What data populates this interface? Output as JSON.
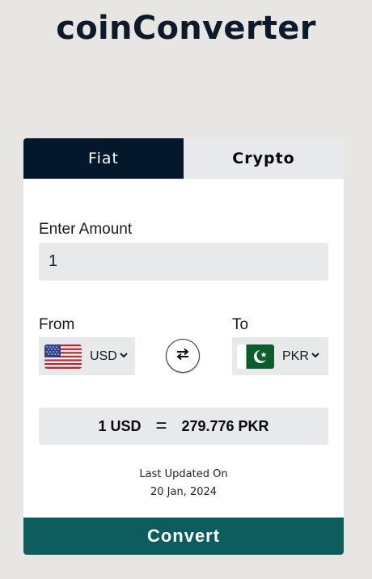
{
  "app_title": "coinConverter",
  "tabs": [
    {
      "label": "Fiat",
      "active": true
    },
    {
      "label": "Crypto",
      "active": false
    }
  ],
  "amount": {
    "label": "Enter Amount",
    "value": "1"
  },
  "from": {
    "label": "From",
    "currency": "USD",
    "flag_icon": "us-flag-icon"
  },
  "to": {
    "label": "To",
    "currency": "PKR",
    "flag_icon": "pk-flag-icon"
  },
  "swap_icon": "swap-arrows-icon",
  "result": {
    "from_text": "1 USD",
    "equals": "=",
    "to_text": "279.776 PKR"
  },
  "last_updated": {
    "label": "Last Updated On",
    "date": "20 Jan, 2024"
  },
  "convert_label": "Convert",
  "colors": {
    "page_bg": "#e7e6e3",
    "title": "#0c1a2b",
    "active_tab": "#03182b",
    "convert_button": "#0d5c5e",
    "field_bg": "#e8e9ea"
  }
}
